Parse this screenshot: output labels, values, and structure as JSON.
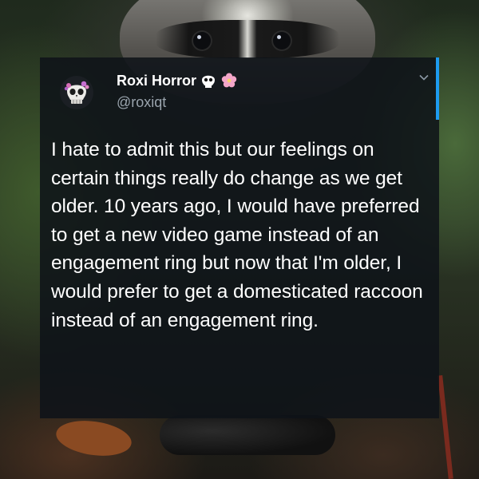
{
  "tweet": {
    "display_name": "Roxi Horror",
    "handle": "@roxiqt",
    "text": "I hate to admit this but our feelings on certain things really do change as we get older. 10 years ago, I would have preferred to get a new video game instead of an engagement ring but now that I'm older, I would prefer to get a domesticated raccoon instead of an engagement ring.",
    "name_emojis": [
      "skull-icon",
      "cherry-blossom-icon"
    ],
    "avatar": "skull-with-flowers-avatar",
    "menu_icon": "chevron-down-icon"
  },
  "colors": {
    "card_background": "#0e1319",
    "accent": "#1d9bf0",
    "handle_text": "#9aa4ad",
    "body_text": "#ffffff"
  },
  "background": "raccoon-in-forest-photo"
}
